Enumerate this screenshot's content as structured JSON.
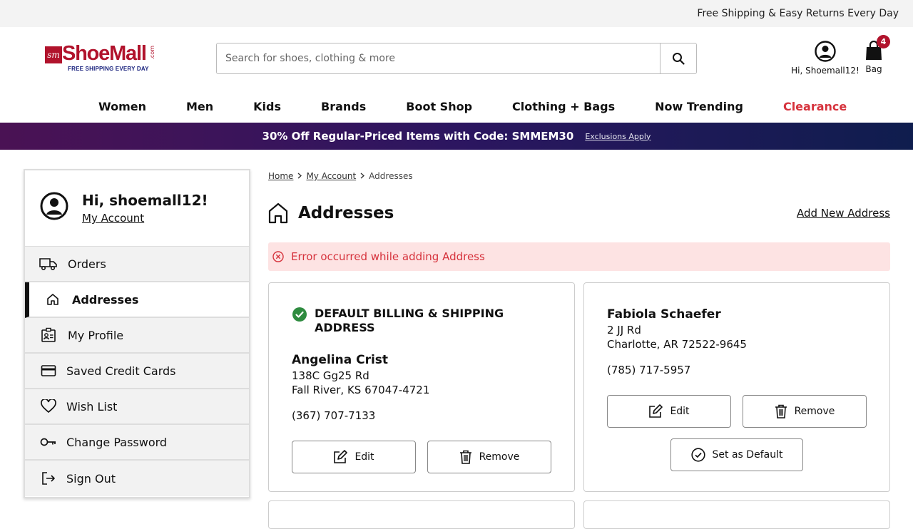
{
  "topbar": {
    "promo": "Free Shipping & Easy Returns Every Day"
  },
  "header": {
    "logo": {
      "brand": "ShoeMall",
      "com": ".com",
      "tagline": "FREE SHIPPING EVERY DAY"
    },
    "search": {
      "placeholder": "Search for shoes, clothing & more"
    },
    "account": {
      "label": "Hi, Shoemall12!"
    },
    "bag": {
      "label": "Bag",
      "count": "4"
    }
  },
  "nav": {
    "items": [
      "Women",
      "Men",
      "Kids",
      "Brands",
      "Boot Shop",
      "Clothing + Bags",
      "Now Trending",
      "Clearance"
    ]
  },
  "promo_banner": {
    "text": "30% Off Regular-Priced Items with Code: SMMEM30",
    "link": "Exclusions Apply"
  },
  "sidebar": {
    "greeting": "Hi, shoemall12!",
    "my_account": "My Account",
    "items": [
      {
        "label": "Orders",
        "icon": "truck-icon"
      },
      {
        "label": "Addresses",
        "icon": "home-icon"
      },
      {
        "label": "My Profile",
        "icon": "profile-card-icon"
      },
      {
        "label": "Saved Credit Cards",
        "icon": "credit-card-icon"
      },
      {
        "label": "Wish List",
        "icon": "heart-icon"
      },
      {
        "label": "Change Password",
        "icon": "key-icon"
      },
      {
        "label": "Sign Out",
        "icon": "sign-out-icon"
      }
    ],
    "active": "Addresses"
  },
  "breadcrumb": {
    "home": "Home",
    "account": "My Account",
    "current": "Addresses"
  },
  "page": {
    "title": "Addresses",
    "add_new": "Add New Address",
    "error": "Error occurred while adding Address"
  },
  "addresses": [
    {
      "default_label": "DEFAULT BILLING & SHIPPING ADDRESS",
      "name": "Angelina Crist",
      "street": "138C Gg25 Rd",
      "city": "Fall River, KS 67047-4721",
      "phone": "(367) 707-7133",
      "edit": "Edit",
      "remove": "Remove"
    },
    {
      "name": "Fabiola Schaefer",
      "street": "2 JJ Rd",
      "city": "Charlotte, AR 72522-9645",
      "phone": "(785) 717-5957",
      "edit": "Edit",
      "remove": "Remove",
      "set_default": "Set as Default"
    }
  ],
  "colors": {
    "brand": "#b1132c",
    "error": "#d6323c",
    "success": "#2e8b3f",
    "promo_start": "#4a1254",
    "promo_end": "#0f1d4e"
  }
}
